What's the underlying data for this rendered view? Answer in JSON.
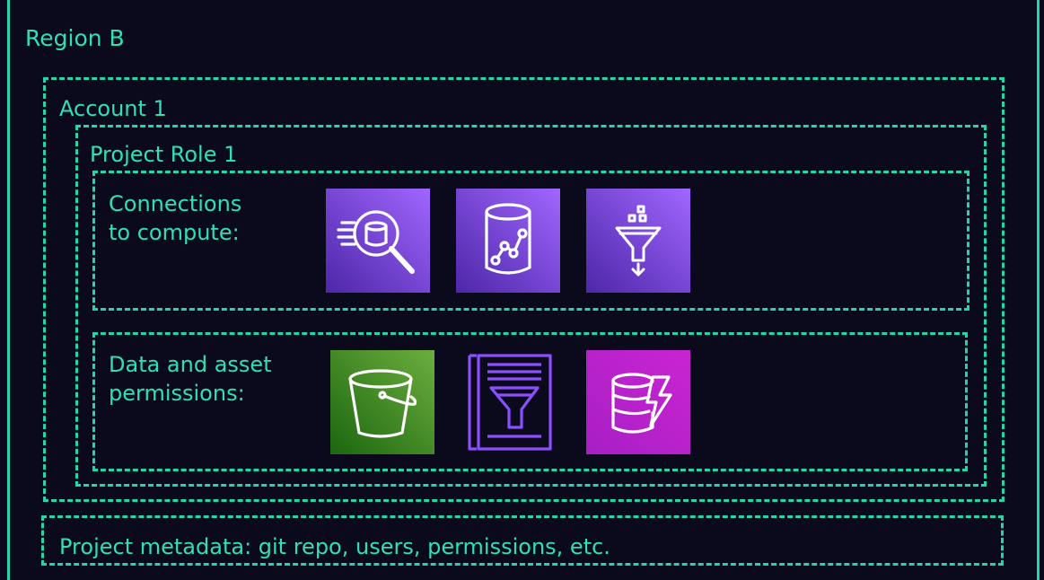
{
  "region": {
    "label": "Region B"
  },
  "account": {
    "label": "Account 1"
  },
  "project_role": {
    "label": "Project Role 1"
  },
  "compute_section": {
    "label_line1": "Connections",
    "label_line2": "to compute:",
    "icons": [
      "athena-query-icon",
      "database-analytics-icon",
      "data-funnel-icon"
    ]
  },
  "data_section": {
    "label_line1": "Data and asset",
    "label_line2": "permissions:",
    "icons": [
      "s3-bucket-icon",
      "glue-catalog-icon",
      "dynamodb-icon"
    ]
  },
  "metadata": {
    "label": "Project metadata: git repo, users, permissions, etc."
  },
  "colors": {
    "background": "#0b0a1c",
    "border": "#22d6a7",
    "text": "#2fe0b6",
    "purple_start": "#4d27a8",
    "purple_end": "#a166ff",
    "green_start": "#1b660f",
    "green_end": "#6cae3e",
    "magenta_start": "#a71fc5",
    "magenta_end": "#c925d1"
  }
}
